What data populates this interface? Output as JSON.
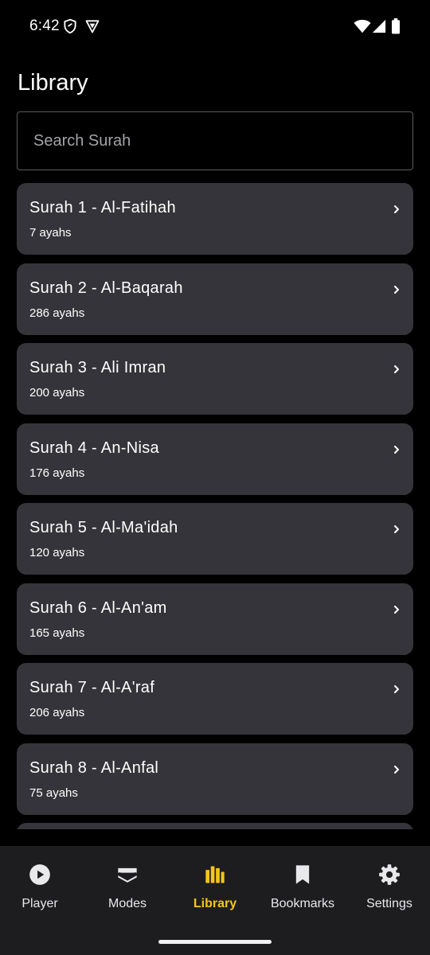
{
  "status_bar": {
    "time": "6:42"
  },
  "page": {
    "title": "Library"
  },
  "search": {
    "placeholder": "Search Surah",
    "value": ""
  },
  "surahs": [
    {
      "title": "Surah 1 - Al-Fatihah",
      "ayahs": "7 ayahs"
    },
    {
      "title": "Surah 2 - Al-Baqarah",
      "ayahs": "286 ayahs"
    },
    {
      "title": "Surah 3 - Ali Imran",
      "ayahs": "200 ayahs"
    },
    {
      "title": "Surah 4 - An-Nisa",
      "ayahs": "176 ayahs"
    },
    {
      "title": "Surah 5 - Al-Ma'idah",
      "ayahs": "120 ayahs"
    },
    {
      "title": "Surah 6 - Al-An'am",
      "ayahs": "165 ayahs"
    },
    {
      "title": "Surah 7 - Al-A'raf",
      "ayahs": "206 ayahs"
    },
    {
      "title": "Surah 8 - Al-Anfal",
      "ayahs": "75 ayahs"
    },
    {
      "title": "",
      "ayahs": ""
    }
  ],
  "bottom_nav": {
    "items": [
      {
        "label": "Player",
        "icon": "play-circle-icon"
      },
      {
        "label": "Modes",
        "icon": "layers-icon"
      },
      {
        "label": "Library",
        "icon": "library-icon",
        "active": true
      },
      {
        "label": "Bookmarks",
        "icon": "bookmark-icon"
      },
      {
        "label": "Settings",
        "icon": "gear-icon"
      }
    ]
  },
  "colors": {
    "background": "#000000",
    "card": "#35343a",
    "nav_background": "#1d1d20",
    "accent": "#f6c518"
  }
}
